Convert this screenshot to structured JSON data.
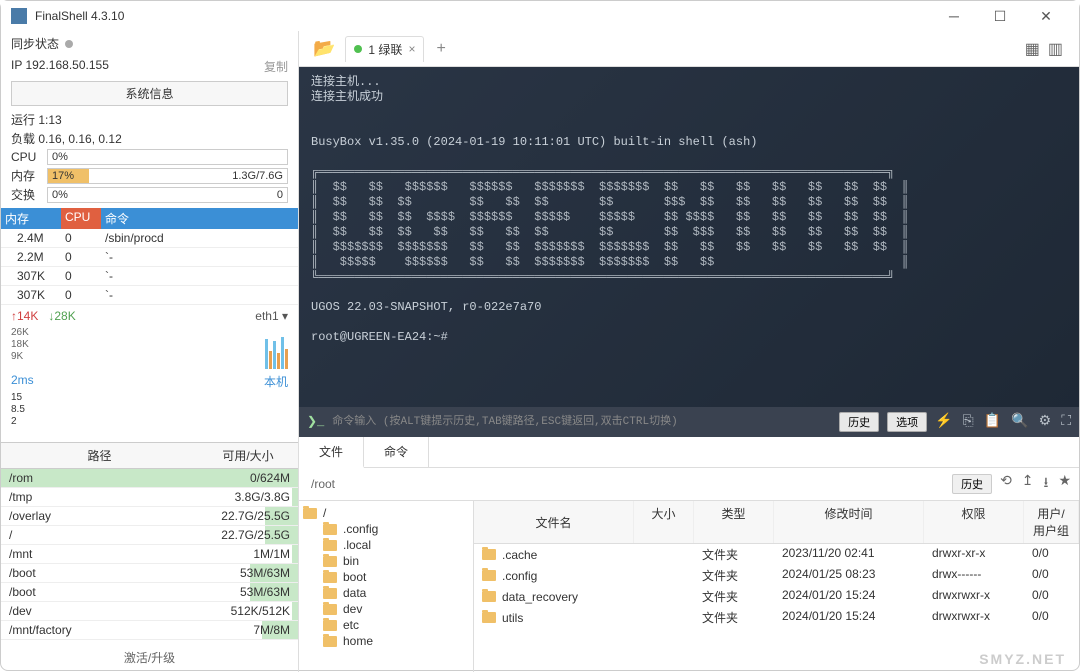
{
  "title": "FinalShell 4.3.10",
  "sync_status_label": "同步状态",
  "ip": "IP  192.168.50.155",
  "copy_label": "复制",
  "sysinfo_label": "系统信息",
  "uptime": "运行 1:13",
  "load": "负载 0.16, 0.16, 0.12",
  "stats": {
    "cpu": {
      "label": "CPU",
      "pct": "0%",
      "fill": 0
    },
    "mem": {
      "label": "内存",
      "pct": "17%",
      "right": "1.3G/7.6G",
      "fill": 17,
      "color": "#f0c068"
    },
    "swap": {
      "label": "交换",
      "pct": "0%",
      "right": "0",
      "fill": 0
    }
  },
  "proc": {
    "headers": {
      "mem": "内存",
      "cpu": "CPU",
      "cmd": "命令"
    },
    "rows": [
      {
        "mem": "2.4M",
        "cpu": "0",
        "cmd": "/sbin/procd"
      },
      {
        "mem": "2.2M",
        "cpu": "0",
        "cmd": "`-"
      },
      {
        "mem": "307K",
        "cpu": "0",
        "cmd": "`-"
      },
      {
        "mem": "307K",
        "cpu": "0",
        "cmd": "`-"
      }
    ]
  },
  "net": {
    "up": "↑14K",
    "down": "↓28K",
    "iface": "eth1 ▾",
    "ylabels": [
      "26K",
      "18K",
      "9K"
    ]
  },
  "ping": {
    "value": "2ms",
    "host": "本机",
    "ylabels": [
      "15",
      "8.5",
      "2"
    ]
  },
  "disk": {
    "headers": {
      "path": "路径",
      "size": "可用/大小"
    },
    "rows": [
      {
        "path": "/rom",
        "size": "0/624M",
        "fill": 100
      },
      {
        "path": "/tmp",
        "size": "3.8G/3.8G",
        "fill": 2
      },
      {
        "path": "/overlay",
        "size": "22.7G/25.5G",
        "fill": 11
      },
      {
        "path": "/",
        "size": "22.7G/25.5G",
        "fill": 11
      },
      {
        "path": "/mnt",
        "size": "1M/1M",
        "fill": 2
      },
      {
        "path": "/boot",
        "size": "53M/63M",
        "fill": 16
      },
      {
        "path": "/boot",
        "size": "53M/63M",
        "fill": 16
      },
      {
        "path": "/dev",
        "size": "512K/512K",
        "fill": 2
      },
      {
        "path": "/mnt/factory",
        "size": "7M/8M",
        "fill": 12
      }
    ]
  },
  "activate_label": "激活/升级",
  "tab": {
    "label": "1 绿联"
  },
  "terminal_lines": [
    "连接主机...",
    "连接主机成功",
    "",
    "",
    "BusyBox v1.35.0 (2024-01-19 10:11:01 UTC) built-in shell (ash)"
  ],
  "ascii": " $$   $$   $$$$$$   $$$$$$   $$$$$$$  $$$$$$$  $$   $$\n $$   $$  $$        $$   $$  $$       $$       $$$  $$\n $$   $$  $$  $$$$  $$$$$$   $$$$$    $$$$$    $$ $$$$\n $$   $$  $$   $$   $$   $$  $$       $$       $$  $$$\n $$$$$$$  $$$$$$$   $$   $$  $$$$$$$  $$$$$$$  $$   $$\n  $$$$$    $$$$$$   $$   $$  $$$$$$$  $$$$$$$  $$   $$",
  "asciibox": "╔═══════════════════════════════════════════════════════════════════════════════╗\n║  $$   $$   $$$$$$   $$$$$$   $$$$$$$  $$$$$$$  $$   $$   $$   $$   $$   $$  $$  ║\n║  $$   $$  $$        $$   $$  $$       $$       $$$  $$   $$   $$   $$   $$  $$  ║\n║  $$   $$  $$  $$$$  $$$$$$   $$$$$    $$$$$    $$ $$$$   $$   $$   $$   $$  $$  ║\n║  $$   $$  $$   $$   $$   $$  $$       $$       $$  $$$   $$   $$   $$   $$  $$  ║\n║  $$$$$$$  $$$$$$$   $$   $$  $$$$$$$  $$$$$$$  $$   $$   $$   $$   $$   $$  $$  ║\n║   $$$$$    $$$$$$   $$   $$  $$$$$$$  $$$$$$$  $$   $$                          ║\n╚═══════════════════════════════════════════════════════════════════════════════╝",
  "ugos": "UGOS 22.03-SNAPSHOT, r0-022e7a70",
  "prompt": "root@UGREEN-EA24:~#",
  "cmd_hint": "命令输入 (按ALT键提示历史,TAB键路径,ESC键返回,双击CTRL切换)",
  "history_btn": "历史",
  "select_btn": "选项",
  "file_tabs": {
    "files": "文件",
    "cmd": "命令"
  },
  "addr": {
    "path": "/root",
    "history": "历史",
    "refresh": "⟳",
    "up": "↥",
    "down": "⭳",
    "bookmark": "★"
  },
  "tree": [
    {
      "name": "/",
      "level": 0
    },
    {
      "name": ".config",
      "level": 1
    },
    {
      "name": ".local",
      "level": 1
    },
    {
      "name": "bin",
      "level": 1
    },
    {
      "name": "boot",
      "level": 1
    },
    {
      "name": "data",
      "level": 1
    },
    {
      "name": "dev",
      "level": 1
    },
    {
      "name": "etc",
      "level": 1
    },
    {
      "name": "home",
      "level": 1
    }
  ],
  "file_headers": {
    "name": "文件名",
    "size": "大小",
    "type": "类型",
    "date": "修改时间",
    "perm": "权限",
    "owner": "用户/用户组"
  },
  "files": [
    {
      "name": ".cache",
      "size": "",
      "type": "文件夹",
      "date": "2023/11/20 02:41",
      "perm": "drwxr-xr-x",
      "owner": "0/0"
    },
    {
      "name": ".config",
      "size": "",
      "type": "文件夹",
      "date": "2024/01/25 08:23",
      "perm": "drwx------",
      "owner": "0/0"
    },
    {
      "name": "data_recovery",
      "size": "",
      "type": "文件夹",
      "date": "2024/01/20 15:24",
      "perm": "drwxrwxr-x",
      "owner": "0/0"
    },
    {
      "name": "utils",
      "size": "",
      "type": "文件夹",
      "date": "2024/01/20 15:24",
      "perm": "drwxrwxr-x",
      "owner": "0/0"
    }
  ],
  "watermark": "SMYZ.NET"
}
